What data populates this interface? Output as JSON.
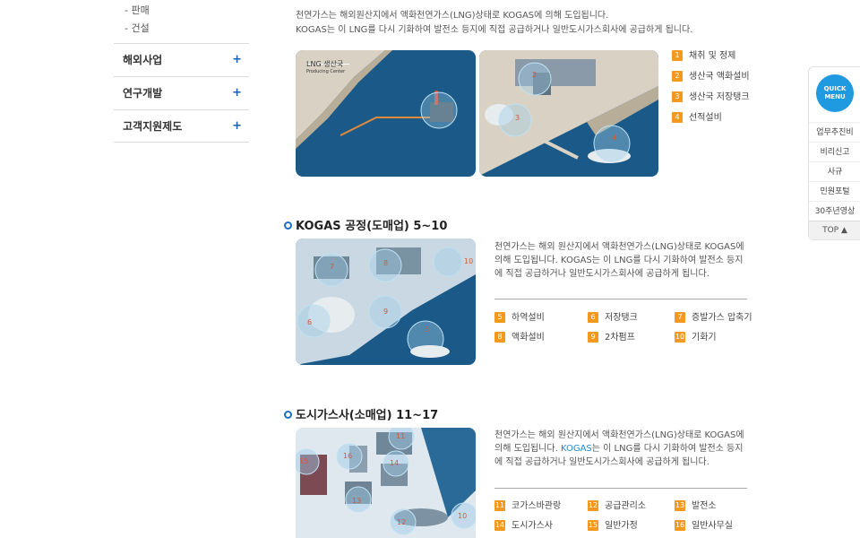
{
  "sidebar": {
    "sub_items": [
      "- 판매",
      "- 건설"
    ],
    "menu": [
      {
        "label": "해외사업",
        "toggle": "+"
      },
      {
        "label": "연구개발",
        "toggle": "+"
      },
      {
        "label": "고객지원제도",
        "toggle": "+"
      }
    ]
  },
  "intro": {
    "line1": "천연가스는 해외원산지에서 액화천연가스(LNG)상태로 KOGAS에 의해 도입됩니다.",
    "line2": "KOGAS는 이 LNG를 다시 기화하여 발전소 등지에 직접 공급하거나 일반도시가스회사에 공급하게 됩니다."
  },
  "figure1": {
    "map_label": "LNG 생산국",
    "map_sublabel": "Producing Center",
    "legend": [
      {
        "num": "1",
        "label": "채취 및 정제"
      },
      {
        "num": "2",
        "label": "생산국 액화설비"
      },
      {
        "num": "3",
        "label": "생산국 저장탱크"
      },
      {
        "num": "4",
        "label": "선적설비"
      }
    ]
  },
  "section2": {
    "title": "KOGAS 공정(도매업) 5~10",
    "desc": "천연가스는 해외 원산지에서 액화천연가스(LNG)상태로 KOGAS에 의해 도입됩니다. KOGAS는 이 LNG를 다시 기화하여 발전소 등지에 직접 공급하거나 일반도시가스회사에 공급하게 됩니다.",
    "legend": [
      {
        "num": "5",
        "label": "하역설비"
      },
      {
        "num": "6",
        "label": "저장탱크"
      },
      {
        "num": "7",
        "label": "증발가스 압축기"
      },
      {
        "num": "8",
        "label": "액화설비"
      },
      {
        "num": "9",
        "label": "2차펌프"
      },
      {
        "num": "10",
        "label": "기화기"
      }
    ]
  },
  "section3": {
    "title": "도시가스사(소매업) 11~17",
    "desc_a": "천연가스는 해외 원산지에서 액화천연가스(LNG)상태로 KOGAS에 의해 도입됩니다.",
    "desc_b": "KOGAS",
    "desc_c": "는 이 LNG를 다시 기화하여 발전소 등지에 직접 공급하거나 일반도시가스회사에 공급하게 됩니다.",
    "legend": [
      {
        "num": "11",
        "label": "코가스바관랑"
      },
      {
        "num": "12",
        "label": "공급관리소"
      },
      {
        "num": "13",
        "label": "발전소"
      },
      {
        "num": "14",
        "label": "도시가스사"
      },
      {
        "num": "15",
        "label": "일반가정"
      },
      {
        "num": "16",
        "label": "일반사무실"
      }
    ]
  },
  "quick": {
    "badge_line1": "QUICK",
    "badge_line2": "MENU",
    "links": [
      "업무추진비",
      "비리신고",
      "사규",
      "민원포털",
      "30주년영상"
    ],
    "top": "TOP ▲"
  },
  "colors": {
    "accent": "#1a6fc4",
    "badge": "#f39a1e",
    "sea": "#1b5a88"
  }
}
